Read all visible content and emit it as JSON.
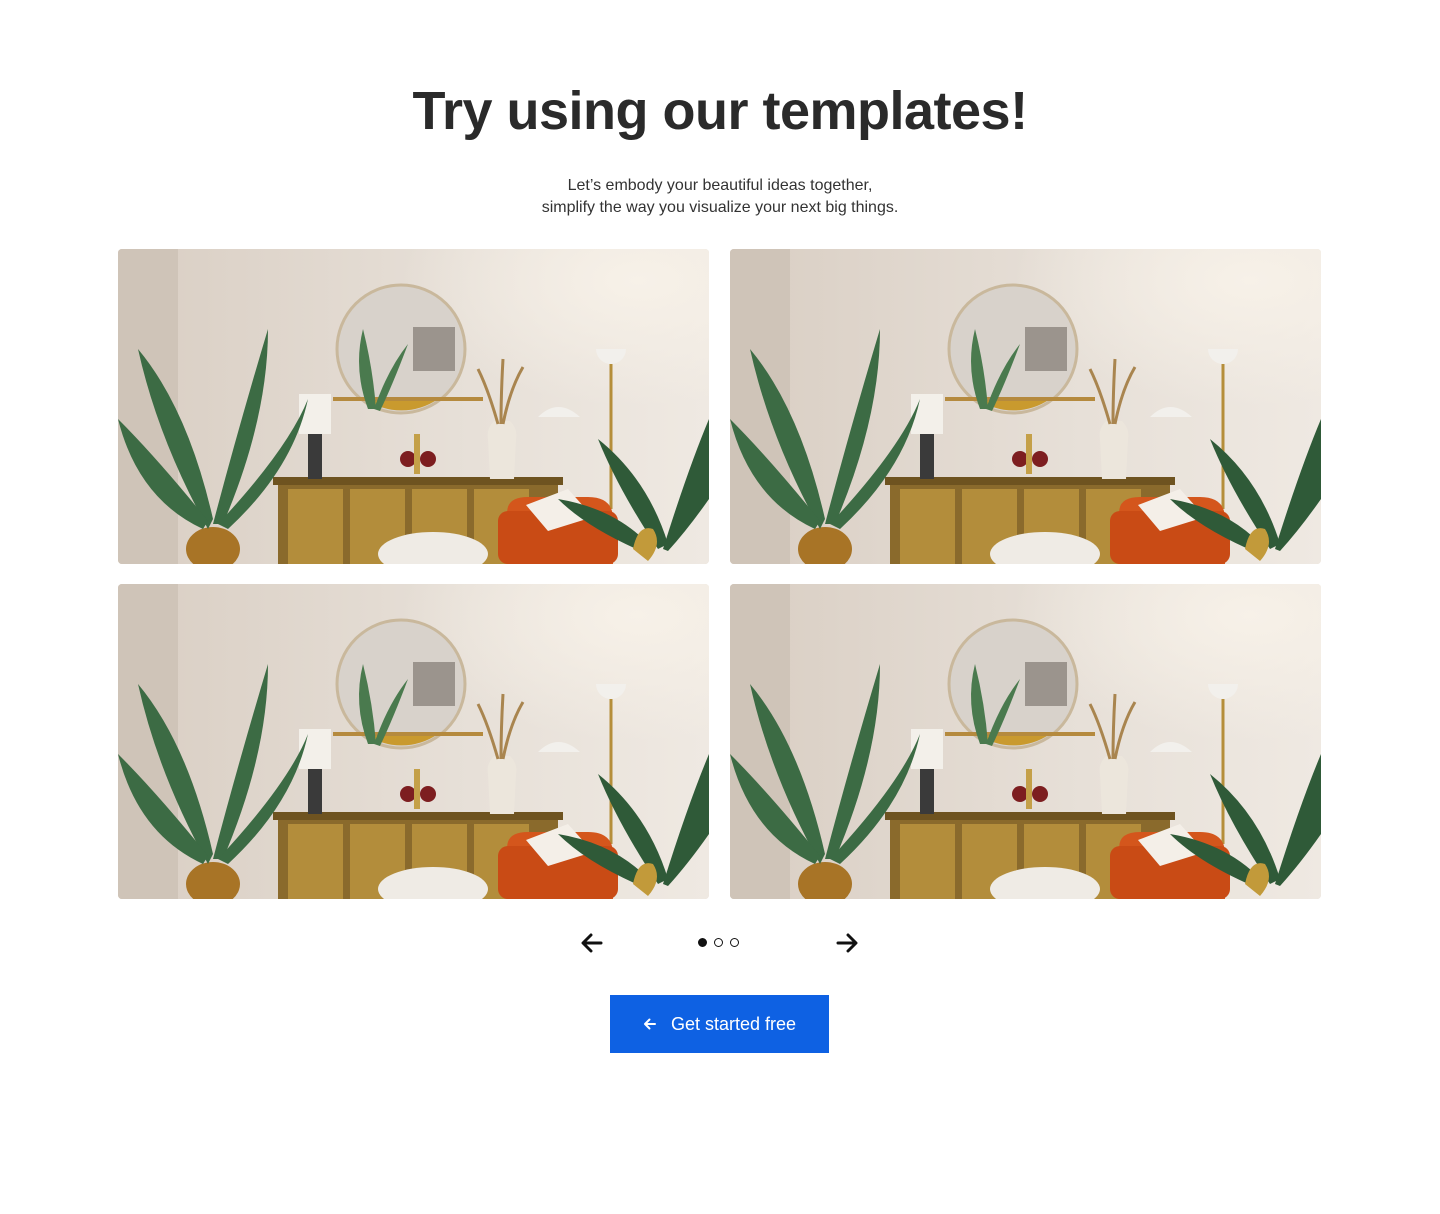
{
  "hero": {
    "title": "Try using our templates!",
    "subtitle_line1": "Let’s embody your beautiful ideas together,",
    "subtitle_line2": "simplify the way you visualize your next big things."
  },
  "templates": [
    {
      "image": "living-room-interior"
    },
    {
      "image": "living-room-interior"
    },
    {
      "image": "living-room-interior"
    },
    {
      "image": "living-room-interior"
    }
  ],
  "pager": {
    "prev_icon": "arrow-left-icon",
    "next_icon": "arrow-right-icon",
    "pages": 3,
    "current_page": 1
  },
  "cta": {
    "label": "Get started free",
    "icon": "arrow-left-icon",
    "color": "#0e61e3"
  }
}
